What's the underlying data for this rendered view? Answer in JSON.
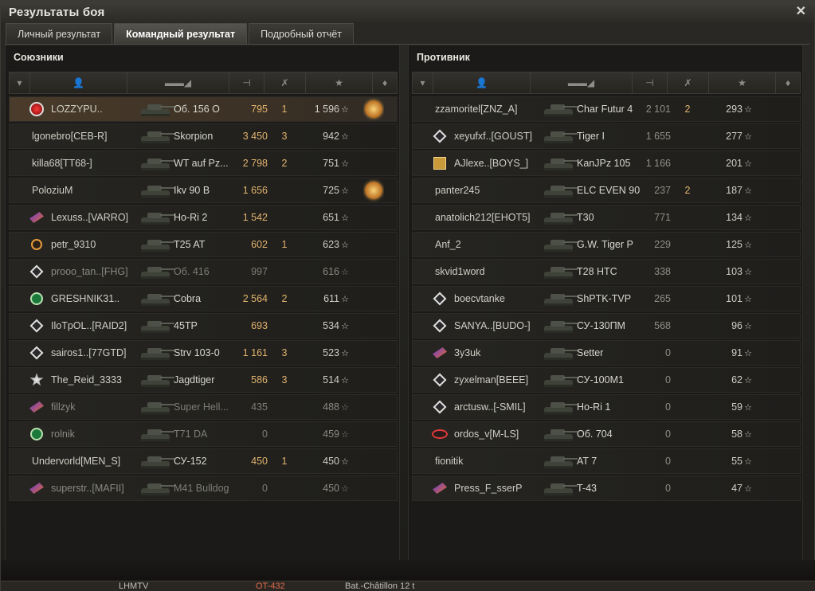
{
  "window": {
    "title": "Результаты боя"
  },
  "tabs": [
    {
      "label": "Личный результат",
      "active": false
    },
    {
      "label": "Командный результат",
      "active": true
    },
    {
      "label": "Подробный отчёт",
      "active": false
    }
  ],
  "allies": {
    "title": "Союзники",
    "rows": [
      {
        "badge": "red-emblem",
        "name": "LOZZYPU..",
        "tank": "Об. 156 О",
        "damage": "795",
        "kills": "1",
        "xp": "1 596",
        "medal": true,
        "me": true,
        "dead": false
      },
      {
        "badge": "",
        "name": "lgonebro[CEB-R]",
        "tank": "Skorpion",
        "damage": "3 450",
        "kills": "3",
        "xp": "942",
        "medal": false,
        "me": false,
        "dead": false
      },
      {
        "badge": "",
        "name": "killa68[TT68-]",
        "tank": "WT auf Pz...",
        "damage": "2 798",
        "kills": "2",
        "xp": "751",
        "medal": false,
        "me": false,
        "dead": false
      },
      {
        "badge": "",
        "name": "PoloziuM",
        "tank": "Ikv 90 B",
        "damage": "1 656",
        "kills": "",
        "xp": "725",
        "medal": true,
        "me": false,
        "dead": false
      },
      {
        "badge": "purple-emblem",
        "name": "Lexuss..[VARRO]",
        "tank": "Ho-Ri 2",
        "damage": "1 542",
        "kills": "",
        "xp": "651",
        "medal": false,
        "me": false,
        "dead": false
      },
      {
        "badge": "orange-emblem",
        "name": "petr_9310",
        "tank": "T25 AT",
        "damage": "602",
        "kills": "1",
        "xp": "623",
        "medal": false,
        "me": false,
        "dead": false
      },
      {
        "badge": "diamond-emblem",
        "name": "prooo_tan..[FHG]",
        "tank": "Об. 416",
        "damage": "997",
        "kills": "",
        "xp": "616",
        "medal": false,
        "me": false,
        "dead": true
      },
      {
        "badge": "green-emblem",
        "name": "GRESHNIK31..",
        "tank": "Cobra",
        "damage": "2 564",
        "kills": "2",
        "xp": "611",
        "medal": false,
        "me": false,
        "dead": false
      },
      {
        "badge": "diamond-emblem",
        "name": "IloTpOL..[RAID2]",
        "tank": "45TP",
        "damage": "693",
        "kills": "",
        "xp": "534",
        "medal": false,
        "me": false,
        "dead": false
      },
      {
        "badge": "diamond-emblem",
        "name": "sairos1..[77GTD]",
        "tank": "Strv 103-0",
        "damage": "1 161",
        "kills": "3",
        "xp": "523",
        "medal": false,
        "me": false,
        "dead": false
      },
      {
        "badge": "star-emblem",
        "name": "The_Reid_3333",
        "tank": "Jagdtiger",
        "damage": "586",
        "kills": "3",
        "xp": "514",
        "medal": false,
        "me": false,
        "dead": false
      },
      {
        "badge": "purple-emblem",
        "name": "fillzyk",
        "tank": "Super Hell...",
        "damage": "435",
        "kills": "",
        "xp": "488",
        "medal": false,
        "me": false,
        "dead": true
      },
      {
        "badge": "green-emblem",
        "name": "rolnik",
        "tank": "T71 DA",
        "damage": "0",
        "kills": "",
        "xp": "459",
        "medal": false,
        "me": false,
        "dead": true
      },
      {
        "badge": "",
        "name": "Undervorld[MEN_S]",
        "tank": "СУ-152",
        "damage": "450",
        "kills": "1",
        "xp": "450",
        "medal": false,
        "me": false,
        "dead": false
      },
      {
        "badge": "purple-emblem",
        "name": "superstr..[MAFII]",
        "tank": "M41 Bulldog",
        "damage": "0",
        "kills": "",
        "xp": "450",
        "medal": false,
        "me": false,
        "dead": true
      }
    ]
  },
  "enemies": {
    "title": "Противник",
    "rows": [
      {
        "badge": "",
        "name": "zzamoritel[ZNZ_A]",
        "tank": "Char Futur 4",
        "damage": "2 101",
        "kills": "2",
        "xp": "293"
      },
      {
        "badge": "diamond-emblem",
        "name": "xeyufxf..[GOUST]",
        "tank": "Tiger I",
        "damage": "1 655",
        "kills": "",
        "xp": "277"
      },
      {
        "badge": "gold-emblem",
        "name": "AJlexe..[BOYS_]",
        "tank": "KanJPz 105",
        "damage": "1 166",
        "kills": "",
        "xp": "201"
      },
      {
        "badge": "",
        "name": "panter245",
        "tank": "ELC EVEN 90",
        "damage": "237",
        "kills": "2",
        "xp": "187"
      },
      {
        "badge": "",
        "name": "anatolich212[EHOT5]",
        "tank": "T30",
        "damage": "771",
        "kills": "",
        "xp": "134"
      },
      {
        "badge": "",
        "name": "Anf_2",
        "tank": "G.W. Tiger P",
        "damage": "229",
        "kills": "",
        "xp": "125"
      },
      {
        "badge": "",
        "name": "skvid1word",
        "tank": "T28 HTC",
        "damage": "338",
        "kills": "",
        "xp": "103"
      },
      {
        "badge": "diamond-emblem",
        "name": "boecvtanke",
        "tank": "ShPTK-TVP",
        "damage": "265",
        "kills": "",
        "xp": "101"
      },
      {
        "badge": "diamond-emblem",
        "name": "SANYA..[BUDO-]",
        "tank": "СУ-130ПМ",
        "damage": "568",
        "kills": "",
        "xp": "96"
      },
      {
        "badge": "purple-emblem",
        "name": "3y3uk",
        "tank": "Setter",
        "damage": "0",
        "kills": "",
        "xp": "91"
      },
      {
        "badge": "diamond-emblem",
        "name": "zyxelman[BEEE]",
        "tank": "СУ-100М1",
        "damage": "0",
        "kills": "",
        "xp": "62"
      },
      {
        "badge": "diamond-emblem",
        "name": "arctusw..[-SMIL]",
        "tank": "Ho-Ri 1",
        "damage": "0",
        "kills": "",
        "xp": "59"
      },
      {
        "badge": "redline-emblem",
        "name": "ordos_v[M-LS]",
        "tank": "Об. 704",
        "damage": "0",
        "kills": "",
        "xp": "58"
      },
      {
        "badge": "",
        "name": "fionitik",
        "tank": "AT 7",
        "damage": "0",
        "kills": "",
        "xp": "55"
      },
      {
        "badge": "purple-emblem",
        "name": "Press_F_sserP",
        "tank": "T-43",
        "damage": "0",
        "kills": "",
        "xp": "47"
      }
    ]
  },
  "bottom_strip": {
    "left_text": "LHMTV",
    "mid_text": "OT-432",
    "right_text": "Bat.-Châtillon 12 t"
  },
  "colors": {
    "accent": "#e1b36e",
    "me_row": "#4a3b2a"
  }
}
